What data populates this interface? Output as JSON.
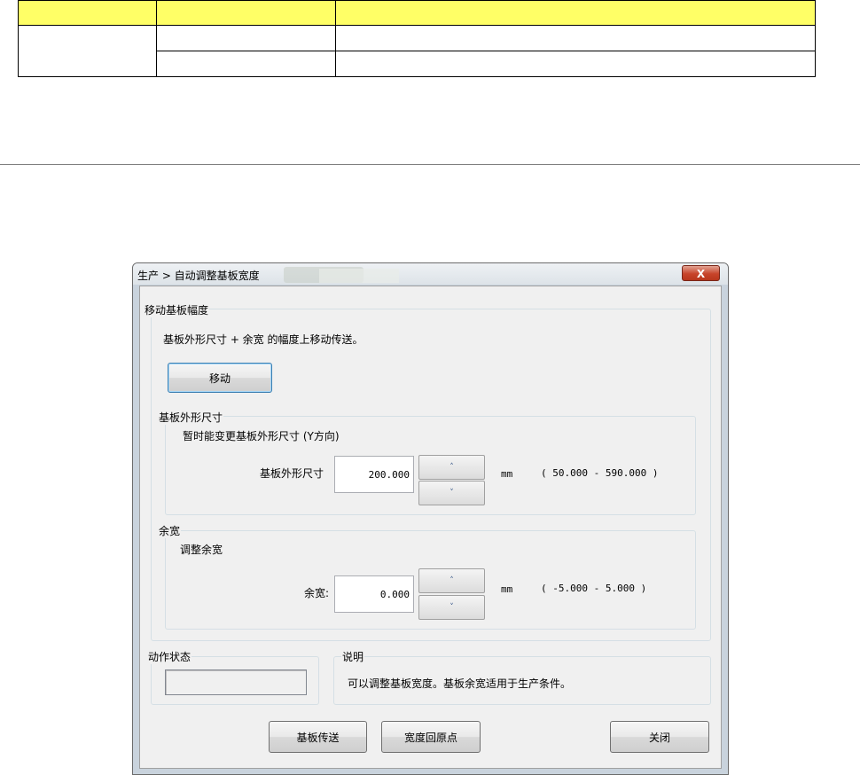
{
  "dialog": {
    "title": "生产 > 自动调整基板宽度",
    "close_label": "X"
  },
  "move_group": {
    "label": "移动基板幅度",
    "description": "基板外形尺寸 + 余宽 的幅度上移动传送。",
    "move_button": "移动"
  },
  "size_group": {
    "label": "基板外形尺寸",
    "description": "暂时能变更基板外形尺寸 (Y方向)",
    "field_label": "基板外形尺寸",
    "value": "200.000",
    "unit": "mm",
    "range": "( 50.000 - 590.000 )",
    "up": "˄",
    "down": "˅"
  },
  "margin_group": {
    "label": "余宽",
    "description": "调整余宽",
    "field_label": "余宽:",
    "value": "0.000",
    "unit": "mm",
    "range": "( -5.000 - 5.000 )",
    "up": "˄",
    "down": "˅"
  },
  "status_group": {
    "label": "动作状态",
    "value": ""
  },
  "info_group": {
    "label": "说明",
    "text": "可以调整基板宽度。基板余宽适用于生产条件。"
  },
  "footer": {
    "transfer_button": "基板传送",
    "origin_button": "宽度回原点",
    "close_button": "关闭"
  }
}
